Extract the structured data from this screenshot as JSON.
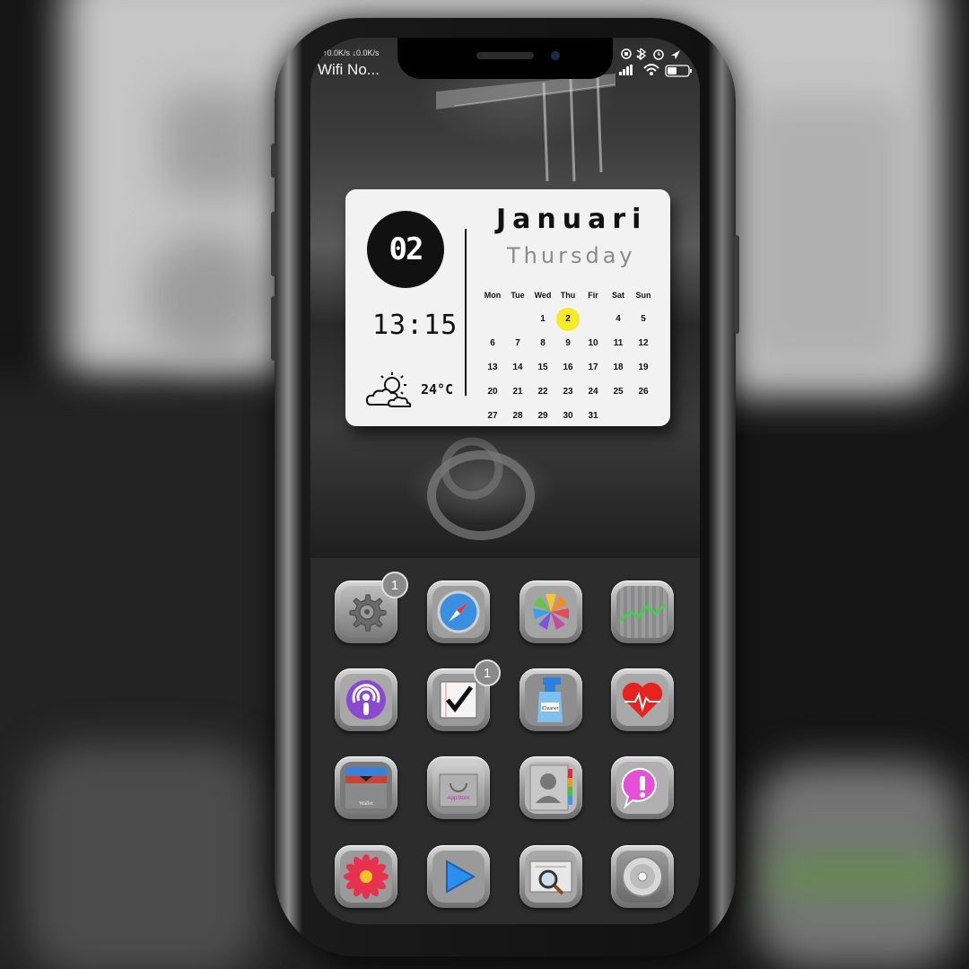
{
  "status_bar": {
    "net_speed": "↑0.0K/s ↓0.0K/s",
    "carrier": "Wifi No..."
  },
  "widget": {
    "day_badge": "02",
    "time": "13:15",
    "temperature": "24°C",
    "month": "Januari",
    "weekday": "Thursday",
    "highlight_color": "#f6ea2a",
    "calendar": {
      "headers": [
        "Mon",
        "Tue",
        "Wed",
        "Thu",
        "Fir",
        "Sat",
        "Sun"
      ],
      "weeks": [
        [
          "",
          "",
          "1",
          "2",
          "4",
          "5"
        ],
        [
          "6",
          "7",
          "8",
          "9",
          "10",
          "11",
          "12"
        ],
        [
          "13",
          "14",
          "15",
          "16",
          "17",
          "18",
          "19"
        ],
        [
          "20",
          "21",
          "22",
          "23",
          "24",
          "25",
          "26"
        ],
        [
          "27",
          "28",
          "29",
          "30",
          "31",
          "",
          ""
        ]
      ],
      "today": "2"
    }
  },
  "apps": [
    {
      "name": "settings",
      "icon": "gear-icon",
      "badge": "1"
    },
    {
      "name": "safari",
      "icon": "compass-icon",
      "badge": ""
    },
    {
      "name": "photos",
      "icon": "pinwheel-icon",
      "badge": ""
    },
    {
      "name": "stocks",
      "icon": "stock-chart-icon",
      "badge": ""
    },
    {
      "name": "podcasts",
      "icon": "podcast-icon",
      "badge": ""
    },
    {
      "name": "reminders",
      "icon": "checkmark-icon",
      "badge": "1"
    },
    {
      "name": "cleaner",
      "icon": "spray-bottle-icon",
      "badge": "",
      "label": "iCleaner"
    },
    {
      "name": "health",
      "icon": "heart-icon",
      "badge": ""
    },
    {
      "name": "wallet",
      "icon": "wallet-icon",
      "badge": "",
      "label": "Wallet"
    },
    {
      "name": "app-store",
      "icon": "shopping-bag-icon",
      "badge": "",
      "label": "AppStore"
    },
    {
      "name": "contacts",
      "icon": "contacts-icon",
      "badge": ""
    },
    {
      "name": "messages",
      "icon": "message-alert-icon",
      "badge": ""
    },
    {
      "name": "flower-app",
      "icon": "flower-icon",
      "badge": ""
    },
    {
      "name": "player",
      "icon": "play-icon",
      "badge": ""
    },
    {
      "name": "files",
      "icon": "file-search-icon",
      "badge": ""
    },
    {
      "name": "music",
      "icon": "speaker-icon",
      "badge": ""
    }
  ]
}
